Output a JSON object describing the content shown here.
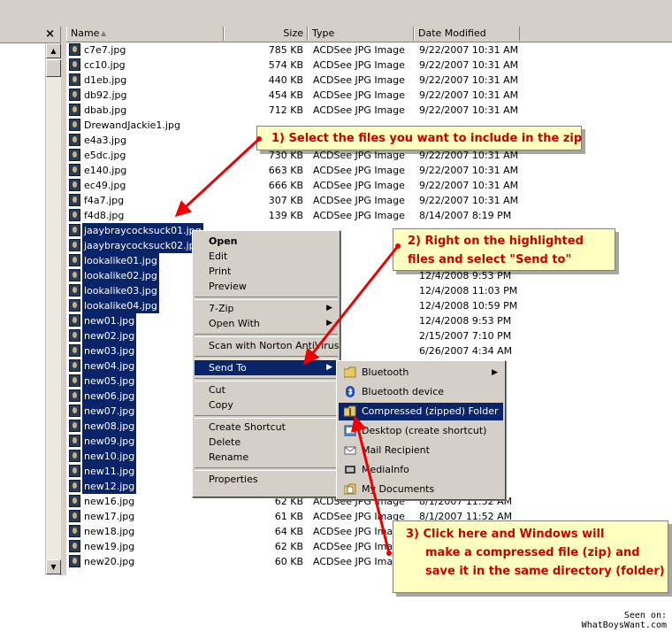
{
  "left_pane": {
    "close_label": "×",
    "scroll_up": "▲",
    "scroll_down": "▼"
  },
  "columns": {
    "name": "Name",
    "size": "Size",
    "type": "Type",
    "date": "Date Modified",
    "sort_indicator": "▲"
  },
  "files": [
    {
      "name": "c7e7.jpg",
      "size": "785 KB",
      "type": "ACDSee JPG Image",
      "date": "9/22/2007 10:31 AM",
      "selected": false
    },
    {
      "name": "cc10.jpg",
      "size": "574 KB",
      "type": "ACDSee JPG Image",
      "date": "9/22/2007 10:31 AM",
      "selected": false
    },
    {
      "name": "d1eb.jpg",
      "size": "440 KB",
      "type": "ACDSee JPG Image",
      "date": "9/22/2007 10:31 AM",
      "selected": false
    },
    {
      "name": "db92.jpg",
      "size": "454 KB",
      "type": "ACDSee JPG Image",
      "date": "9/22/2007 10:31 AM",
      "selected": false
    },
    {
      "name": "dbab.jpg",
      "size": "712 KB",
      "type": "ACDSee JPG Image",
      "date": "9/22/2007 10:31 AM",
      "selected": false
    },
    {
      "name": "DrewandJackie1.jpg",
      "size": "",
      "type": "",
      "date": "",
      "selected": false
    },
    {
      "name": "e4a3.jpg",
      "size": "",
      "type": "",
      "date": "",
      "selected": false
    },
    {
      "name": "e5dc.jpg",
      "size": "730 KB",
      "type": "ACDSee JPG Image",
      "date": "9/22/2007 10:31 AM",
      "selected": false
    },
    {
      "name": "e140.jpg",
      "size": "663 KB",
      "type": "ACDSee JPG Image",
      "date": "9/22/2007 10:31 AM",
      "selected": false
    },
    {
      "name": "ec49.jpg",
      "size": "666 KB",
      "type": "ACDSee JPG Image",
      "date": "9/22/2007 10:31 AM",
      "selected": false
    },
    {
      "name": "f4a7.jpg",
      "size": "307 KB",
      "type": "ACDSee JPG Image",
      "date": "9/22/2007 10:31 AM",
      "selected": false
    },
    {
      "name": "f4d8.jpg",
      "size": "139 KB",
      "type": "ACDSee JPG Image",
      "date": "8/14/2007 8:19 PM",
      "selected": false
    },
    {
      "name": "jaaybraycocksuck01.jpg",
      "size": "",
      "type": "",
      "date": "",
      "selected": true
    },
    {
      "name": "jaaybraycocksuck02.jpg",
      "size": "",
      "type": "",
      "date": "",
      "selected": true
    },
    {
      "name": "lookalike01.jpg",
      "size": "",
      "type": "",
      "date": "",
      "selected": true
    },
    {
      "name": "lookalike02.jpg",
      "size": "",
      "type": "",
      "date": "12/4/2008 9:53 PM",
      "selected": true
    },
    {
      "name": "lookalike03.jpg",
      "size": "",
      "type": "",
      "date": "12/4/2008 11:03 PM",
      "selected": true
    },
    {
      "name": "lookalike04.jpg",
      "size": "",
      "type": "",
      "date": "12/4/2008 10:59 PM",
      "selected": true
    },
    {
      "name": "new01.jpg",
      "size": "",
      "type": "",
      "date": "12/4/2008 9:53 PM",
      "selected": true
    },
    {
      "name": "new02.jpg",
      "size": "",
      "type": "",
      "date": "2/15/2007 7:10 PM",
      "selected": true
    },
    {
      "name": "new03.jpg",
      "size": "",
      "type": "",
      "date": "6/26/2007 4:34 AM",
      "selected": true
    },
    {
      "name": "new04.jpg",
      "size": "",
      "type": "",
      "date": "",
      "selected": true
    },
    {
      "name": "new05.jpg",
      "size": "",
      "type": "",
      "date": "",
      "selected": true
    },
    {
      "name": "new06.jpg",
      "size": "",
      "type": "",
      "date": "",
      "selected": true
    },
    {
      "name": "new07.jpg",
      "size": "",
      "type": "",
      "date": "",
      "selected": true
    },
    {
      "name": "new08.jpg",
      "size": "",
      "type": "",
      "date": "",
      "selected": true
    },
    {
      "name": "new09.jpg",
      "size": "",
      "type": "",
      "date": "",
      "selected": true
    },
    {
      "name": "new10.jpg",
      "size": "",
      "type": "",
      "date": "",
      "selected": true
    },
    {
      "name": "new11.jpg",
      "size": "",
      "type": "",
      "date": "",
      "selected": true
    },
    {
      "name": "new12.jpg",
      "size": "",
      "type": "",
      "date": "",
      "selected": true
    },
    {
      "name": "new16.jpg",
      "size": "62 KB",
      "type": "ACDSee JPG Image",
      "date": "8/1/2007 11:52 AM",
      "selected": false
    },
    {
      "name": "new17.jpg",
      "size": "61 KB",
      "type": "ACDSee JPG Image",
      "date": "8/1/2007 11:52 AM",
      "selected": false
    },
    {
      "name": "new18.jpg",
      "size": "64 KB",
      "type": "ACDSee JPG Image",
      "date": "",
      "selected": false
    },
    {
      "name": "new19.jpg",
      "size": "62 KB",
      "type": "ACDSee JPG Image",
      "date": "",
      "selected": false
    },
    {
      "name": "new20.jpg",
      "size": "60 KB",
      "type": "ACDSee JPG Image",
      "date": "",
      "selected": false
    }
  ],
  "context_menu": {
    "items": [
      {
        "label": "Open",
        "bold": true
      },
      {
        "label": "Edit"
      },
      {
        "label": "Print"
      },
      {
        "label": "Preview"
      },
      {
        "sep": true
      },
      {
        "label": "7-Zip",
        "sub": true
      },
      {
        "label": "Open With",
        "sub": true
      },
      {
        "sep": true
      },
      {
        "label": "Scan with Norton AntiVirus"
      },
      {
        "sep": true
      },
      {
        "label": "Send To",
        "sub": true,
        "hl": true
      },
      {
        "sep": true
      },
      {
        "label": "Cut"
      },
      {
        "label": "Copy"
      },
      {
        "sep": true
      },
      {
        "label": "Create Shortcut"
      },
      {
        "label": "Delete"
      },
      {
        "label": "Rename"
      },
      {
        "sep": true
      },
      {
        "label": "Properties"
      }
    ]
  },
  "sendto_menu": {
    "items": [
      {
        "label": "Bluetooth",
        "icon": "folder-icon",
        "sub": true
      },
      {
        "label": "Bluetooth device",
        "icon": "bluetooth-icon"
      },
      {
        "label": "Compressed (zipped) Folder",
        "icon": "zip-folder-icon",
        "hl": true
      },
      {
        "label": "Desktop (create shortcut)",
        "icon": "desktop-icon"
      },
      {
        "label": "Mail Recipient",
        "icon": "mail-icon"
      },
      {
        "label": "MediaInfo",
        "icon": "mediainfo-icon"
      },
      {
        "label": "My Documents",
        "icon": "my-documents-icon"
      }
    ]
  },
  "callouts": {
    "step1": "1) Select the files you want to include in the zip",
    "step2_line1": "2) Right on the highlighted",
    "step2_line2": "files and select \"Send to\"",
    "step3_line1": "3) Click here and Windows will",
    "step3_line2": "make a compressed file (zip) and",
    "step3_line3": "save it in the same directory (folder)"
  },
  "watermark": {
    "line1": "Seen on:",
    "line2": "WhatBoysWant.com"
  },
  "colors": {
    "selection": "#0a246a",
    "callout_bg": "#ffffc0",
    "callout_text": "#cc0000",
    "arrow": "#ee0000"
  }
}
